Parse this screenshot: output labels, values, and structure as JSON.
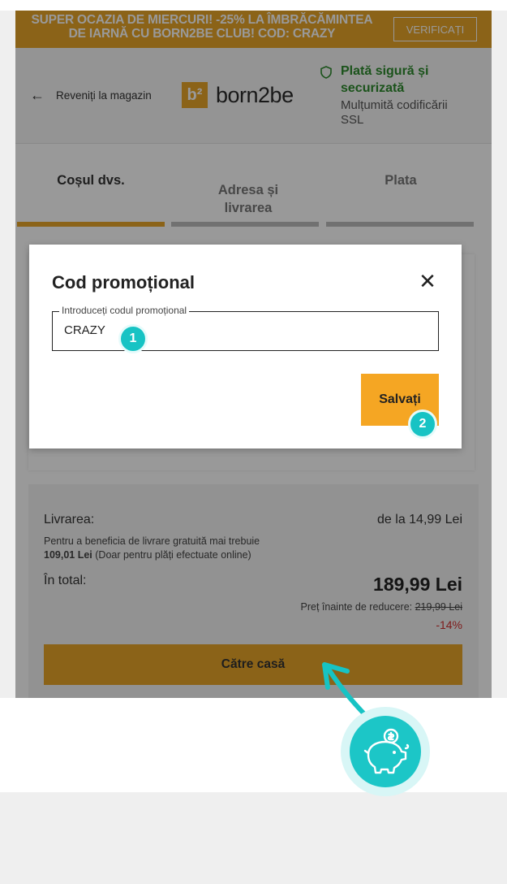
{
  "promo_banner": {
    "text_line1": "SUPER OCAZIA DE MIERCURI! -25% LA ÎMBRĂCĂMINTEA",
    "text_line2": "DE IARNĂ CU BORN2BE CLUB! COD: CRAZY",
    "button_label": "VERIFICAȚI"
  },
  "header": {
    "back_label": "Reveniți la magazin",
    "logo_mark": "b²",
    "logo_text": "born2be",
    "secure_title": "Plată sigură și securizată",
    "secure_subtitle": "Mulțumită codificării SSL"
  },
  "steps": [
    {
      "label": "Coșul dvs.",
      "active": true
    },
    {
      "label": "Adresa și livrarea",
      "active": false
    },
    {
      "label": "Plata",
      "active": false
    }
  ],
  "modal": {
    "title": "Cod promoțional",
    "close_icon": "close-icon",
    "field_label": "Introduceți codul promoțional",
    "field_value": "CRAZY",
    "save_label": "Salvați"
  },
  "summary": {
    "delivery_label": "Livrarea:",
    "delivery_value": "de la 14,99 Lei",
    "free_delivery_note_1": "Pentru a beneficia de livrare gratuită mai trebuie",
    "free_delivery_amount": "109,01 Lei",
    "free_delivery_note_2": "(Doar pentru plăți efectuate online)",
    "total_label": "În total:",
    "total_value": "189,99 Lei",
    "before_discount_label": "Preț înainte de reducere:",
    "before_discount_value": "219,99 Lei",
    "discount_percent": "-14%",
    "checkout_label": "Către casă"
  },
  "annotations": {
    "marker_1": "1",
    "marker_2": "2"
  },
  "colors": {
    "accent": "#e8a629",
    "save_button": "#f5a623",
    "secure_green": "#2e8a2e",
    "discount_red": "#d32f2f",
    "marker_teal": "#17c3c4"
  }
}
